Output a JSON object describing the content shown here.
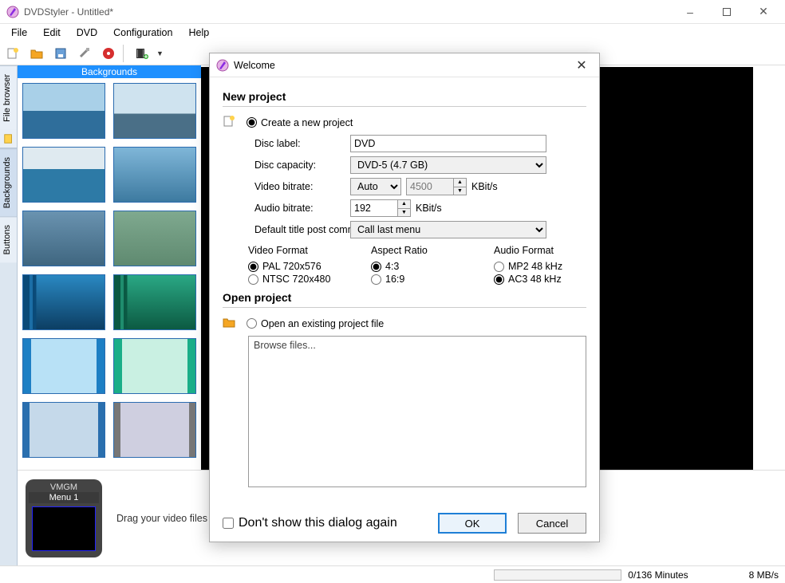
{
  "window": {
    "title": "DVDStyler - Untitled*"
  },
  "menubar": [
    "File",
    "Edit",
    "DVD",
    "Configuration",
    "Help"
  ],
  "toolbar_icons": [
    "new-project-icon",
    "open-icon",
    "save-icon",
    "settings-icon",
    "burn-icon",
    "add-file-icon"
  ],
  "sidetabs": {
    "file_browser": "File browser",
    "backgrounds": "Backgrounds",
    "buttons": "Buttons"
  },
  "bg_panel": {
    "header": "Backgrounds"
  },
  "drag_hint": "Drag your video files t",
  "vmgm": {
    "label": "VMGM",
    "menu": "Menu 1"
  },
  "status": {
    "minutes": "0/136 Minutes",
    "rate": "8 MB/s"
  },
  "dialog": {
    "title": "Welcome",
    "new_project": "New project",
    "create_label": "Create a new project",
    "disc_label_l": "Disc label:",
    "disc_label_v": "DVD",
    "disc_cap_l": "Disc capacity:",
    "disc_cap_v": "DVD-5 (4.7 GB)",
    "vbit_l": "Video bitrate:",
    "vbit_mode": "Auto",
    "vbit_num": "4500",
    "abit_l": "Audio bitrate:",
    "abit_num": "192",
    "kbits": "KBit/s",
    "post_l": "Default title post command:",
    "post_v": "Call last menu",
    "vfmt_h": "Video Format",
    "vfmt_pal": "PAL 720x576",
    "vfmt_ntsc": "NTSC 720x480",
    "ar_h": "Aspect Ratio",
    "ar_43": "4:3",
    "ar_169": "16:9",
    "afmt_h": "Audio Format",
    "afmt_mp2": "MP2 48 kHz",
    "afmt_ac3": "AC3 48 kHz",
    "open_h": "Open project",
    "open_label": "Open an existing project file",
    "browse": "Browse files...",
    "dont_show": "Don't show this dialog again",
    "ok": "OK",
    "cancel": "Cancel"
  }
}
